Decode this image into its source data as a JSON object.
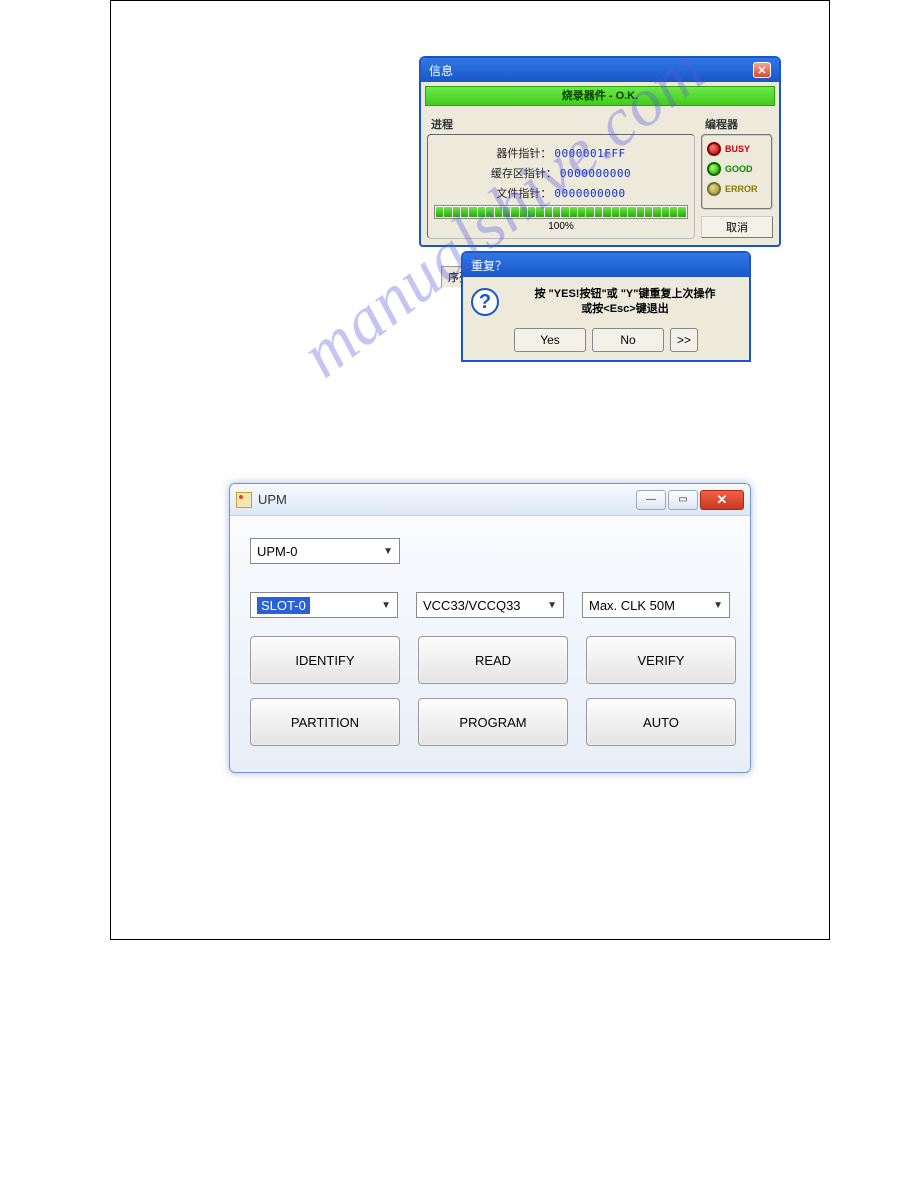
{
  "info_dialog": {
    "title": "信息",
    "ok_bar": "烧录器件 - O.K.",
    "progress_label": "进程",
    "programmer_label": "编程器",
    "ptr1_label": "器件指针：",
    "ptr1_value": "0000001FFF",
    "ptr2_label": "缓存区指针：",
    "ptr2_value": "0000000000",
    "ptr3_label": "文件指针：",
    "ptr3_value": "0000000000",
    "percent": "100%",
    "led_busy": "BUSY",
    "led_good": "GOOD",
    "led_error": "ERROR",
    "cancel": "取消"
  },
  "sequence_tab": "序列",
  "confirm_dialog": {
    "title": "重复？",
    "message_line1": "按 \"YES!按钮\"或 \"Y\"键重复上次操作",
    "message_line2": "或按<Esc>键退出",
    "yes": "Yes",
    "no": "No",
    "more": ">>"
  },
  "watermark": "manualshive.com",
  "upm_window": {
    "title": "UPM",
    "combo_device": "UPM-0",
    "combo_slot": "SLOT-0",
    "combo_vcc": "VCC33/VCCQ33",
    "combo_clk": "Max. CLK 50M",
    "btn_identify": "IDENTIFY",
    "btn_read": "READ",
    "btn_verify": "VERIFY",
    "btn_partition": "PARTITION",
    "btn_program": "PROGRAM",
    "btn_auto": "AUTO",
    "min_glyph": "—",
    "max_glyph": "▭",
    "close_glyph": "✕"
  }
}
